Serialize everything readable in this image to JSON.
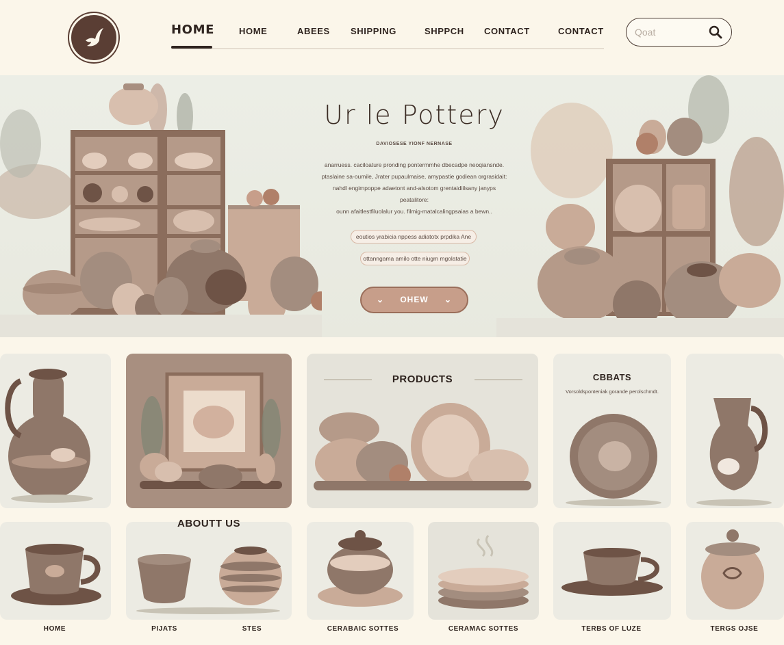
{
  "header": {
    "nav_active": "HOME",
    "nav_items": [
      "HOME",
      "ABEES",
      "SHIPPING",
      "SHPPCH",
      "CONTACT",
      "CONTACT"
    ],
    "search": {
      "placeholder": "Qoat"
    }
  },
  "hero": {
    "title": "Ur le Pottery",
    "subtitle": "DAVIOSESE YIONF NERNASE",
    "paragraph": [
      "anarruess. caciloature pronding pontermmhe dbecadpe neoqiansnde.",
      "ptaslaine sa-oumile, Jrater pupaulmaise, amypastie godiean orgrasidait:",
      "nahdl engimpoppe adaetont and-alsotom grentaidiilsany janyps peatalitore:",
      "ounn afaitlestfiluolalur you. filmig-matalcalingpsaias a bewn.."
    ],
    "pill_1": "eoutios yrabicia nppess adiatotx prpdika Ane",
    "pill_2": "ottanngama amilo otte niugm mgolatatie",
    "cta": "OHEW"
  },
  "cards": {
    "products_title": "PRODUCTS",
    "cbbats_title": "CBBATS",
    "cbbats_sub": "Vorsoldsponteniak gorande perolschmdt.",
    "about_us": "ABOUTT US"
  },
  "bottom_labels": [
    "HOME",
    "PIJATS",
    "STES",
    "CERABAIC SOTTES",
    "CERAMAC SOTTES",
    "TERBS OF LUZE",
    "TERGS OJSE"
  ],
  "colors": {
    "background": "#fbf6ea",
    "accent": "#c79e8a",
    "dark_brown": "#5a3e34",
    "hero_bg": "#eceee6"
  }
}
